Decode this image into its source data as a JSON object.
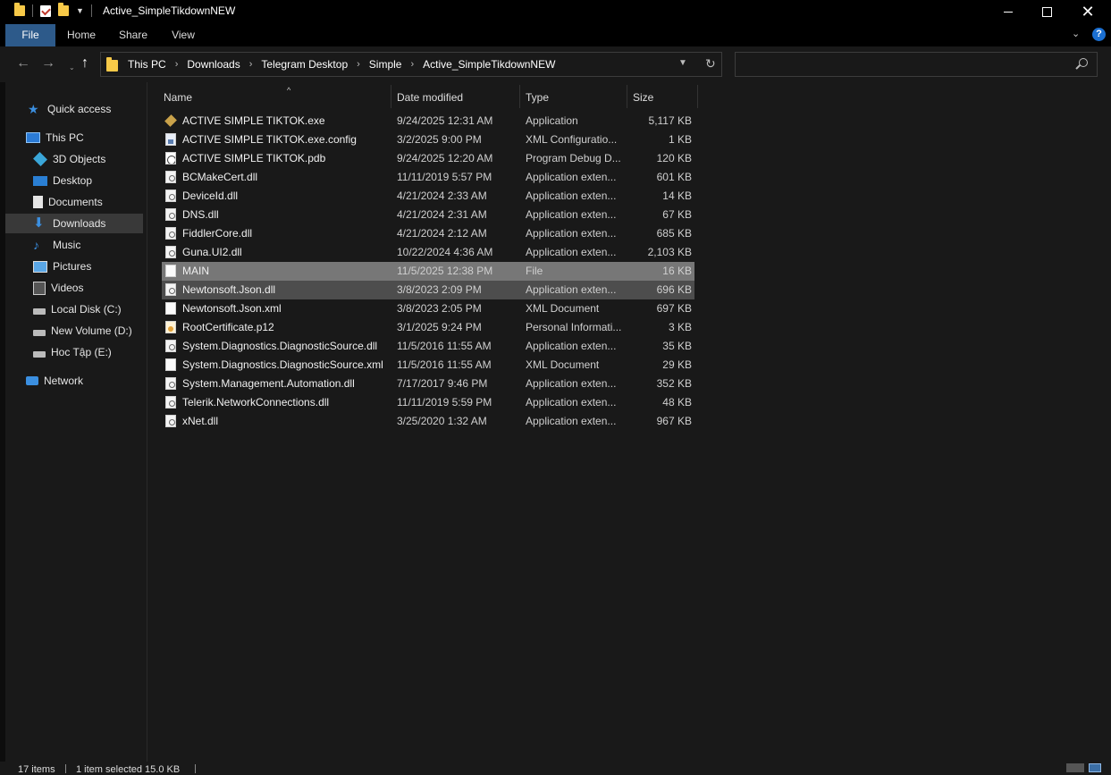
{
  "window": {
    "title": "Active_SimpleTikdownNEW",
    "controls": {
      "minimize": "—",
      "close": "✕"
    }
  },
  "ribbon": {
    "tabs": [
      "File",
      "Home",
      "Share",
      "View"
    ],
    "help": "?",
    "accent": "#2d5a8a"
  },
  "nav": {
    "back": "←",
    "forward": "→",
    "history": "⌄",
    "up": "↑",
    "breadcrumb": [
      "This PC",
      "Downloads",
      "Telegram Desktop",
      "Simple",
      "Active_SimpleTikdownNEW"
    ],
    "crumb_separator": "›",
    "refresh": "↻",
    "search_placeholder": ""
  },
  "sidebar": {
    "items": [
      {
        "label": "Quick access",
        "icon": "star-icon"
      },
      {
        "label": "This PC",
        "icon": "computer-icon"
      },
      {
        "label": "3D Objects",
        "icon": "cube-icon"
      },
      {
        "label": "Desktop",
        "icon": "desktop-icon"
      },
      {
        "label": "Documents",
        "icon": "document-icon"
      },
      {
        "label": "Downloads",
        "icon": "download-icon",
        "selected": true
      },
      {
        "label": "Music",
        "icon": "music-icon"
      },
      {
        "label": "Pictures",
        "icon": "pictures-icon"
      },
      {
        "label": "Videos",
        "icon": "videos-icon"
      },
      {
        "label": "Local Disk (C:)",
        "icon": "drive-icon"
      },
      {
        "label": "New Volume (D:)",
        "icon": "drive-icon"
      },
      {
        "label": "Hoc Tập  (E:)",
        "icon": "drive-icon"
      },
      {
        "label": "Network",
        "icon": "network-icon"
      }
    ]
  },
  "columns": {
    "name": "Name",
    "date": "Date modified",
    "type": "Type",
    "size": "Size"
  },
  "files": [
    {
      "name": "ACTIVE SIMPLE TIKTOK.exe",
      "date": "9/24/2025 12:31 AM",
      "type": "Application",
      "size": "5,117 KB",
      "icon": "exe"
    },
    {
      "name": "ACTIVE SIMPLE TIKTOK.exe.config",
      "date": "3/2/2025 9:00 PM",
      "type": "XML Configuratio...",
      "size": "1 KB",
      "icon": "cfg"
    },
    {
      "name": "ACTIVE SIMPLE TIKTOK.pdb",
      "date": "9/24/2025 12:20 AM",
      "type": "Program Debug D...",
      "size": "120 KB",
      "icon": "pdb"
    },
    {
      "name": "BCMakeCert.dll",
      "date": "11/11/2019 5:57 PM",
      "type": "Application exten...",
      "size": "601 KB",
      "icon": "dll"
    },
    {
      "name": "DeviceId.dll",
      "date": "4/21/2024 2:33 AM",
      "type": "Application exten...",
      "size": "14 KB",
      "icon": "dll"
    },
    {
      "name": "DNS.dll",
      "date": "4/21/2024 2:31 AM",
      "type": "Application exten...",
      "size": "67 KB",
      "icon": "dll"
    },
    {
      "name": "FiddlerCore.dll",
      "date": "4/21/2024 2:12 AM",
      "type": "Application exten...",
      "size": "685 KB",
      "icon": "dll"
    },
    {
      "name": "Guna.UI2.dll",
      "date": "10/22/2024 4:36 AM",
      "type": "Application exten...",
      "size": "2,103 KB",
      "icon": "dll"
    },
    {
      "name": "MAIN",
      "date": "11/5/2025 12:38 PM",
      "type": "File",
      "size": "16 KB",
      "icon": "blank",
      "state": "sel"
    },
    {
      "name": "Newtonsoft.Json.dll",
      "date": "3/8/2023 2:09 PM",
      "type": "Application exten...",
      "size": "696 KB",
      "icon": "dll",
      "state": "hov"
    },
    {
      "name": "Newtonsoft.Json.xml",
      "date": "3/8/2023 2:05 PM",
      "type": "XML Document",
      "size": "697 KB",
      "icon": "blank"
    },
    {
      "name": "RootCertificate.p12",
      "date": "3/1/2025 9:24 PM",
      "type": "Personal Informati...",
      "size": "3 KB",
      "icon": "cert"
    },
    {
      "name": "System.Diagnostics.DiagnosticSource.dll",
      "date": "11/5/2016 11:55 AM",
      "type": "Application exten...",
      "size": "35 KB",
      "icon": "dll"
    },
    {
      "name": "System.Diagnostics.DiagnosticSource.xml",
      "date": "11/5/2016 11:55 AM",
      "type": "XML Document",
      "size": "29 KB",
      "icon": "blank"
    },
    {
      "name": "System.Management.Automation.dll",
      "date": "7/17/2017 9:46 PM",
      "type": "Application exten...",
      "size": "352 KB",
      "icon": "dll"
    },
    {
      "name": "Telerik.NetworkConnections.dll",
      "date": "11/11/2019 5:59 PM",
      "type": "Application exten...",
      "size": "48 KB",
      "icon": "dll"
    },
    {
      "name": "xNet.dll",
      "date": "3/25/2020 1:32 AM",
      "type": "Application exten...",
      "size": "967 KB",
      "icon": "dll"
    }
  ],
  "status": {
    "item_count": "17 items",
    "selection": "1 item selected  15.0 KB"
  }
}
